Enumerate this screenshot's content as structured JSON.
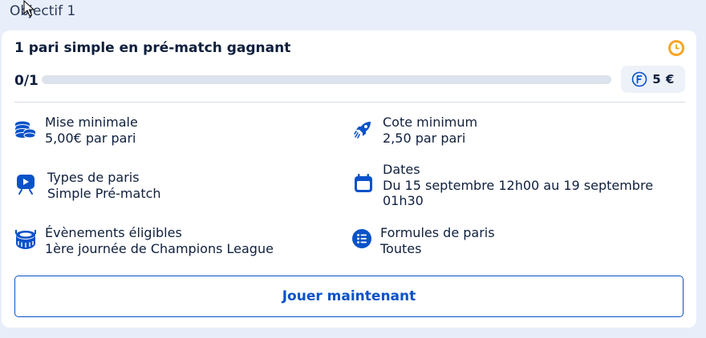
{
  "objective": {
    "title": "Objectif 1"
  },
  "card": {
    "title": "1 pari simple en pré-match gagnant",
    "progress": {
      "text": "0/1",
      "current": 0,
      "total": 1
    },
    "reward": {
      "amount": "5 €",
      "icon": "freebet-coin-icon"
    },
    "details": {
      "min_stake": {
        "label": "Mise minimale",
        "value": "5,00€ par pari",
        "icon": "coins-stack-icon"
      },
      "min_odds": {
        "label": "Cote minimum",
        "value": "2,50 par pari",
        "icon": "rocket-icon"
      },
      "bet_types": {
        "label": "Types de paris",
        "value": "Simple Pré-match",
        "icon": "tv-play-icon"
      },
      "dates": {
        "label": "Dates",
        "value_line1": "Du 15 septembre 12h00 au 19 septembre",
        "value_line2": "01h30",
        "icon": "calendar-icon"
      },
      "events": {
        "label": "Évènements éligibles",
        "value": "1ère journée de Champions League",
        "icon": "stadium-icon"
      },
      "formulas": {
        "label": "Formules de paris",
        "value": "Toutes",
        "icon": "list-icon"
      }
    },
    "cta": {
      "label": "Jouer maintenant"
    }
  },
  "colors": {
    "primary": "#0a52c8",
    "accent_clock": "#f5a623",
    "background": "#e8eefa"
  }
}
